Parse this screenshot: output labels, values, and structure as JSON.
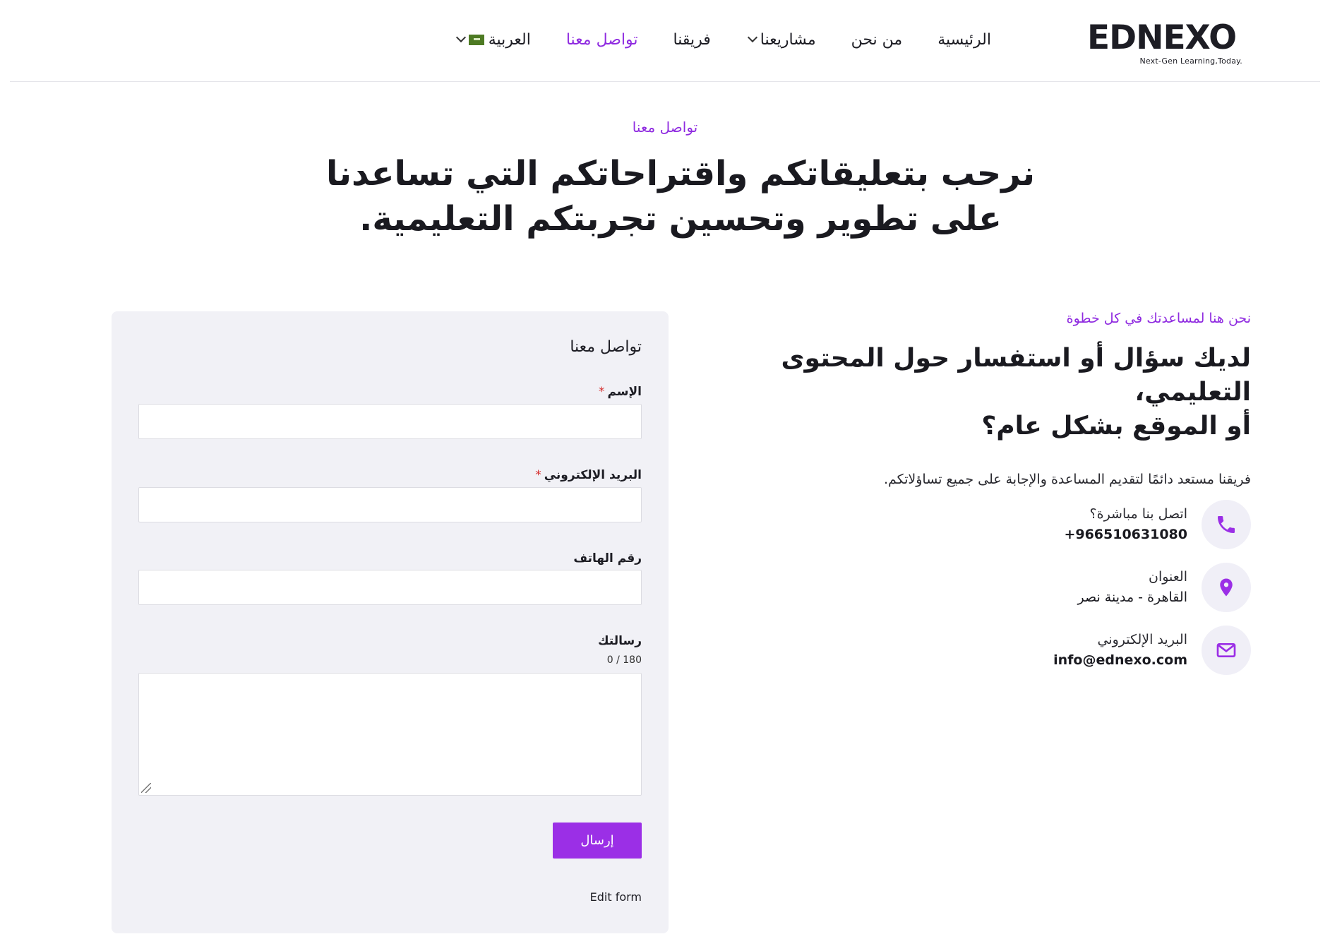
{
  "header": {
    "logo_text": "EDNEXO",
    "logo_tagline": "Next-Gen Learning,Today.",
    "nav": [
      {
        "label": "الرئيسية",
        "active": false,
        "dropdown": false
      },
      {
        "label": "من نحن",
        "active": false,
        "dropdown": false
      },
      {
        "label": "مشاريعنا",
        "active": false,
        "dropdown": true
      },
      {
        "label": "فريقنا",
        "active": false,
        "dropdown": false
      },
      {
        "label": "تواصل معنا",
        "active": true,
        "dropdown": false
      }
    ],
    "language": {
      "label": "العربية",
      "flag": "saudi-flag-icon"
    }
  },
  "hero": {
    "eyebrow": "تواصل معنا",
    "title_line1": "نرحب بتعليقاتكم واقتراحاتكم التي تساعدنا",
    "title_line2": "على تطوير وتحسين تجربتكم التعليمية."
  },
  "info": {
    "eyebrow": "نحن هنا لمساعدتك في كل خطوة",
    "title_line1": "لديك سؤال أو استفسار حول المحتوى التعليمي،",
    "title_line2": "أو الموقع بشكل عام؟",
    "description": "فريقنا مستعد دائمًا لتقديم المساعدة والإجابة على جميع تساؤلاتكم.",
    "contacts": [
      {
        "icon": "phone-icon",
        "label": "اتصل بنا مباشرة؟",
        "value": "+966510631080"
      },
      {
        "icon": "location-pin-icon",
        "label": "العنوان",
        "value": "القاهرة - مدينة نصر"
      },
      {
        "icon": "envelope-icon",
        "label": "البريد الإلكتروني",
        "value": "info@ednexo.com"
      }
    ]
  },
  "form": {
    "title": "تواصل معنا",
    "name_label": "الإسم",
    "email_label": "البريد الإلكتروني",
    "phone_label": "رقم الهاتف",
    "message_label": "رسالتك",
    "required_mark": "*",
    "counter": "0 / 180",
    "submit_label": "إرسال",
    "edit_label": "Edit form"
  },
  "colors": {
    "accent": "#9b2fe6",
    "accent_text": "#8f2be0",
    "card_bg": "#f1f1f6",
    "icon_circle_bg": "#f0eff7"
  }
}
